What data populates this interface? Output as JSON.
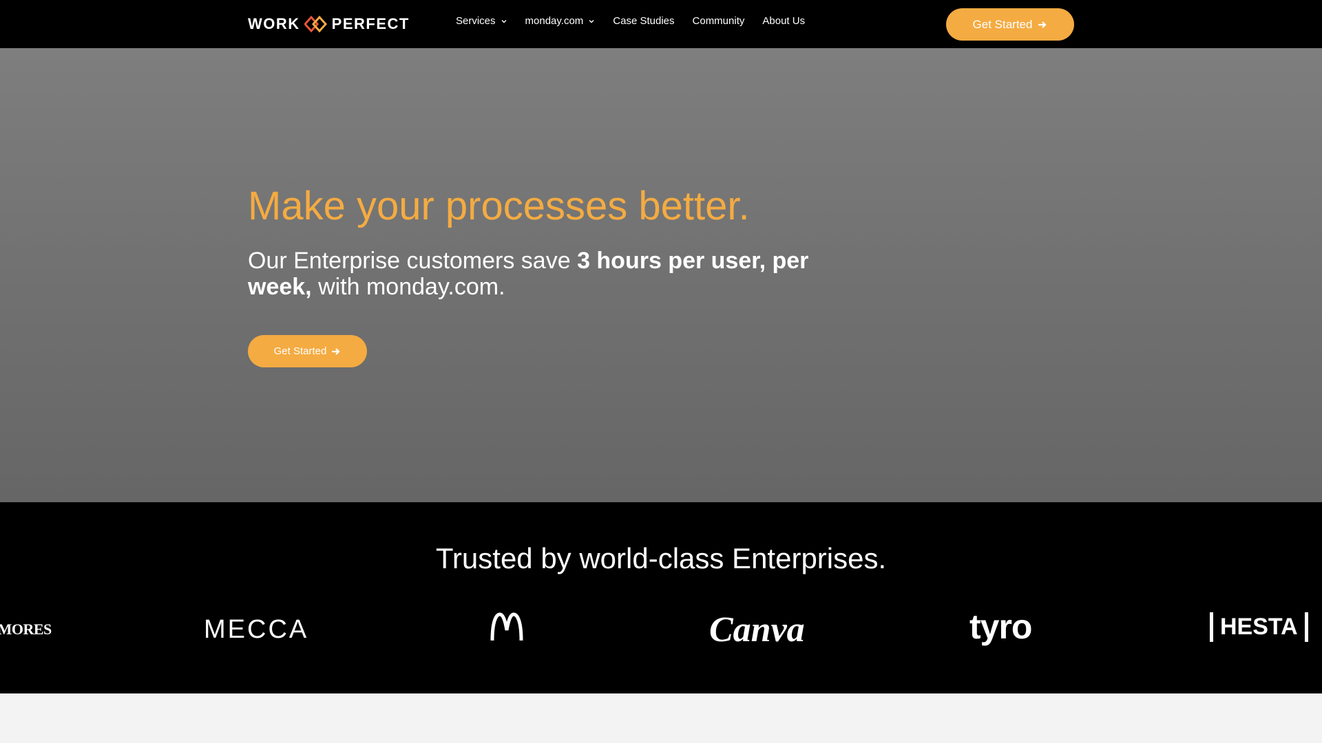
{
  "header": {
    "logo_text_left": "WORK",
    "logo_text_right": "PERFECT",
    "nav": [
      {
        "label": "Services",
        "has_dropdown": true
      },
      {
        "label": "monday.com",
        "has_dropdown": true
      },
      {
        "label": "Case Studies",
        "has_dropdown": false
      },
      {
        "label": "Community",
        "has_dropdown": false
      },
      {
        "label": "About Us",
        "has_dropdown": false
      }
    ],
    "cta_label": "Get Started"
  },
  "hero": {
    "title": "Make your processes better.",
    "subtitle_part1": "Our Enterprise customers save ",
    "subtitle_bold": "3 hours per user, per week,",
    "subtitle_part2": " with monday.com.",
    "cta_label": "Get Started"
  },
  "trusted": {
    "title": "Trusted by world-class Enterprises.",
    "logos": [
      {
        "name": "kmores-logo",
        "text": "KMORES"
      },
      {
        "name": "mecca-logo",
        "text": "MECCA"
      },
      {
        "name": "mcdonalds-logo",
        "text": ""
      },
      {
        "name": "canva-logo",
        "text": "Canva"
      },
      {
        "name": "tyro-logo",
        "text": "tyro"
      },
      {
        "name": "hesta-logo",
        "text": "HESTA"
      }
    ]
  },
  "colors": {
    "accent": "#f4ab42",
    "header_bg": "#000000",
    "hero_bg": "#737373",
    "trusted_bg": "#000000"
  }
}
